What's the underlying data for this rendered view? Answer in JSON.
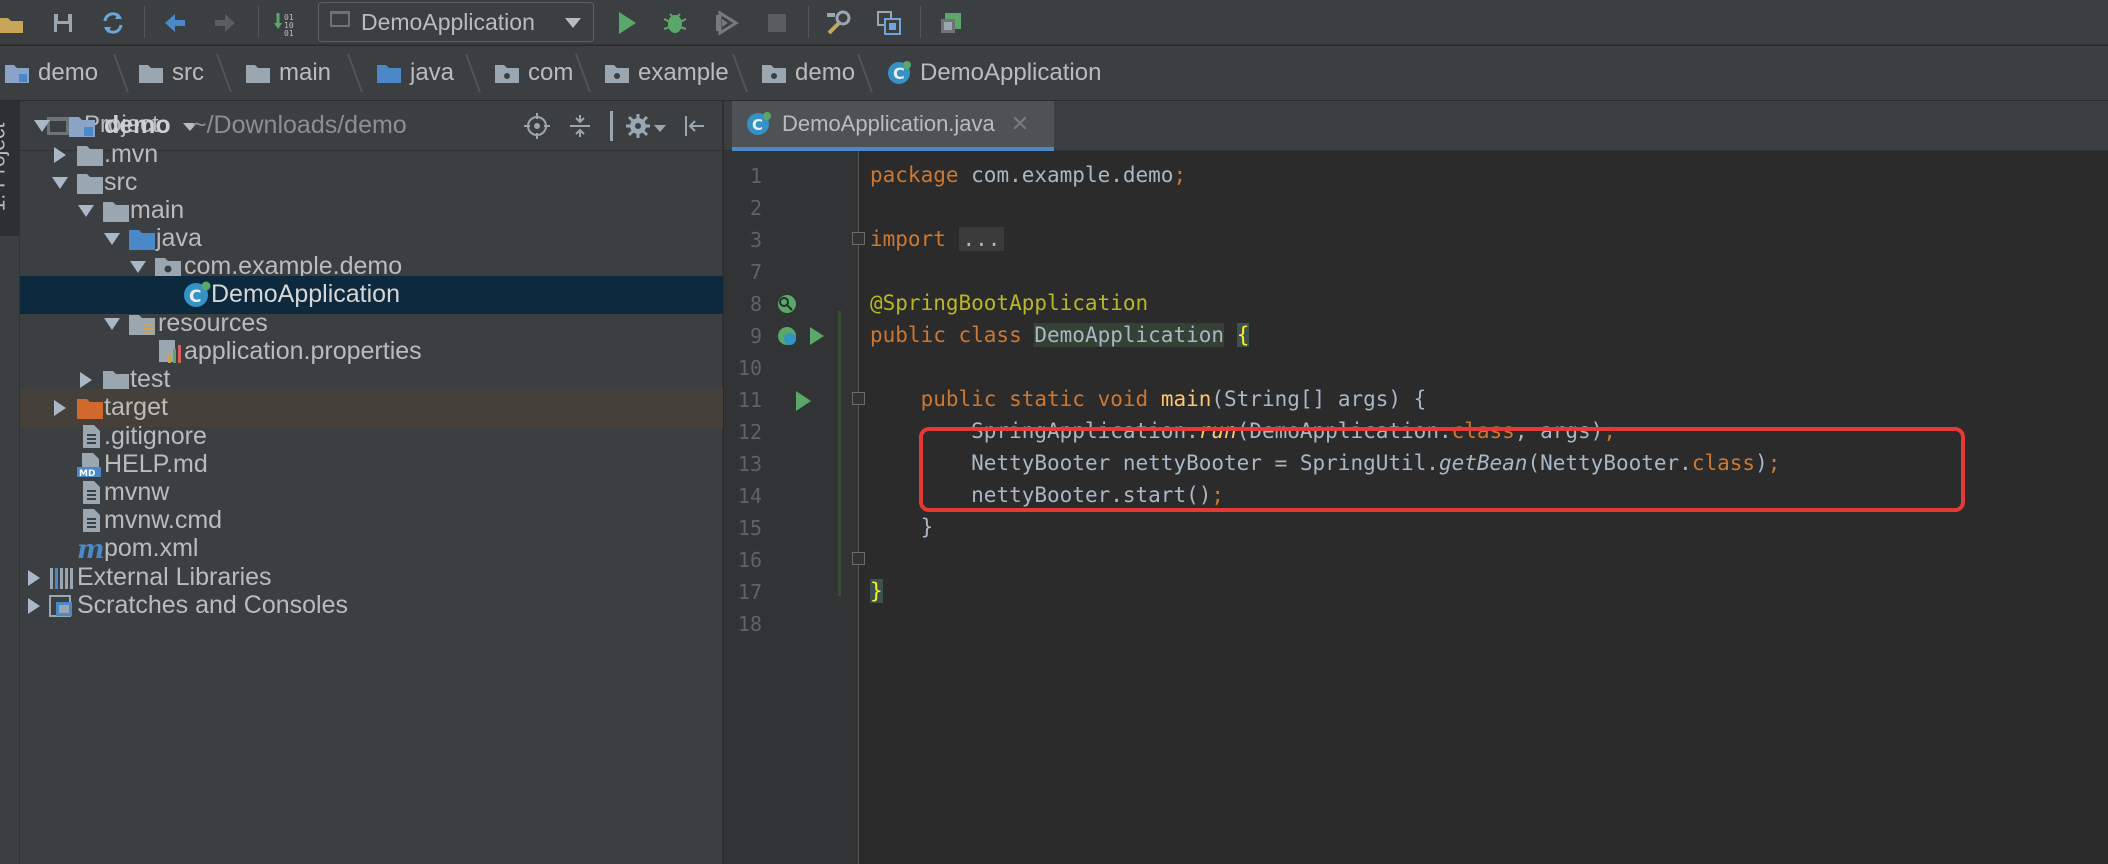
{
  "toolbar": {
    "run_config": "DemoApplication",
    "icons": [
      "open-folder-icon",
      "save-icon",
      "sync-icon",
      "back-icon",
      "forward-icon",
      "build-icon",
      "run-icon",
      "debug-icon",
      "coverage-icon",
      "stop-icon",
      "project-structure-icon",
      "sdk-icon",
      "sync-gradle-icon"
    ]
  },
  "breadcrumb": {
    "items": [
      "demo",
      "src",
      "main",
      "java",
      "com",
      "example",
      "demo",
      "DemoApplication"
    ]
  },
  "left_strip": {
    "tab_label": "1: Project"
  },
  "project": {
    "title": "Project",
    "tree": [
      {
        "label": "demo",
        "suffix": "~/Downloads/demo"
      },
      {
        "label": ".mvn"
      },
      {
        "label": "src"
      },
      {
        "label": "main"
      },
      {
        "label": "java"
      },
      {
        "label": "com.example.demo"
      },
      {
        "label": "DemoApplication"
      },
      {
        "label": "resources"
      },
      {
        "label": "application.properties"
      },
      {
        "label": "test"
      },
      {
        "label": "target"
      },
      {
        "label": ".gitignore"
      },
      {
        "label": "HELP.md"
      },
      {
        "label": "mvnw"
      },
      {
        "label": "mvnw.cmd"
      },
      {
        "label": "pom.xml"
      },
      {
        "label": "External Libraries"
      },
      {
        "label": "Scratches and Consoles"
      }
    ]
  },
  "editor": {
    "tab_label": "DemoApplication.java",
    "line_numbers": [
      "1",
      "2",
      "3",
      "7",
      "8",
      "9",
      "10",
      "11",
      "12",
      "13",
      "14",
      "15",
      "16",
      "17",
      "18"
    ],
    "code": {
      "l1_kw": "package",
      "l1_rest": " com.example.demo",
      "l1_semi": ";",
      "l3_kw": "import",
      "l3_fold": "...",
      "l8_ann": "@SpringBootApplication",
      "l9_kw": "public class",
      "l9_cls": "DemoApplication",
      "l9_brace": "{",
      "l11_kw": "public static void",
      "l11_fn": "main",
      "l11_rest": "(String[] args) {",
      "l12_a": "SpringApplication.",
      "l12_fn": "run",
      "l12_b": "(DemoApplication.",
      "l12_kw": "class",
      "l12_c": ", args)",
      "l12_semi": ";",
      "l13_a": "NettyBooter nettyBooter = SpringUtil.",
      "l13_fn": "getBean",
      "l13_b": "(NettyBooter.",
      "l13_kw": "class",
      "l13_c": ")",
      "l13_semi": ";",
      "l14_a": "nettyBooter.start()",
      "l14_semi": ";",
      "l15": "}",
      "l17": "}"
    }
  }
}
